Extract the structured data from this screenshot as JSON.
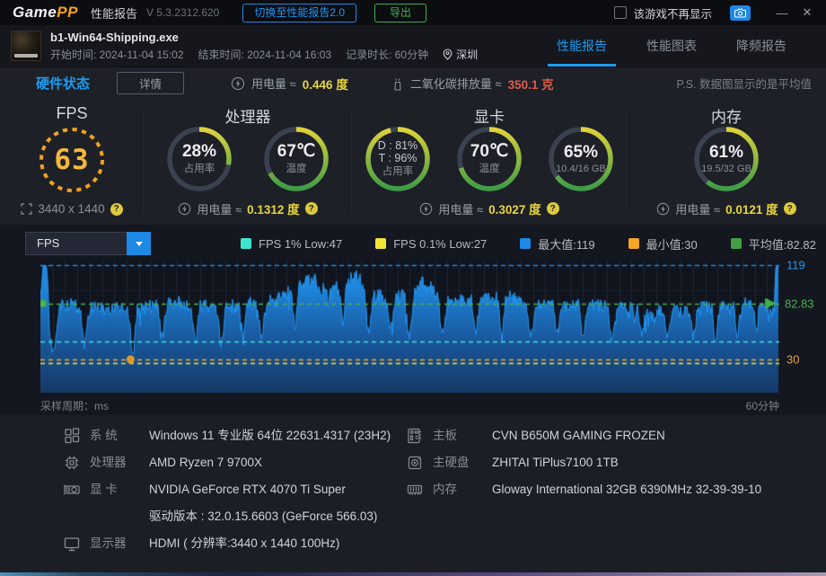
{
  "titlebar": {
    "logo_game": "Game",
    "logo_pp": "PP",
    "title": "性能报告",
    "version": "V 5.3.2312.620",
    "switch_button": "切换至性能报告2.0",
    "export_button": "导出",
    "checkbox_label": "该游戏不再显示",
    "minimize": "—",
    "close": "✕"
  },
  "header": {
    "exe_name": "b1-Win64-Shipping.exe",
    "start_time": "开始时间: 2024-11-04 15:02",
    "end_time": "结束时间: 2024-11-04 16:03",
    "duration": "记录时长: 60分钟",
    "location": "深圳",
    "tabs": [
      {
        "label": "性能报告",
        "active": true
      },
      {
        "label": "性能图表",
        "active": false
      },
      {
        "label": "降频报告",
        "active": false
      }
    ]
  },
  "status_row": {
    "title": "硬件状态",
    "detail_button": "详情",
    "power_label": "用电量 ≈",
    "power_value": "0.446 度",
    "co2_label": "二氧化碳排放量 ≈",
    "co2_value": "350.1 克",
    "ps_note": "P.S. 数据图显示的是平均值"
  },
  "gauges": {
    "fps": {
      "title": "FPS",
      "value": "63",
      "resolution": "3440 x 1440"
    },
    "cpu": {
      "title": "处理器",
      "usage_value": "28%",
      "usage_label": "占用率",
      "usage_pct": 28,
      "temp_value": "67℃",
      "temp_label": "温度",
      "temp_pct": 67,
      "power_label": "用电量 ≈",
      "power_value": "0.1312 度"
    },
    "gpu": {
      "title": "显卡",
      "d_value": "D : 81%",
      "t_value": "T : 96%",
      "usage_label": "占用率",
      "usage_pct": 96,
      "temp_value": "70℃",
      "temp_label": "温度",
      "temp_pct": 70,
      "mem_value": "65%",
      "mem_sub": "10.4/16 GB",
      "mem_pct": 65,
      "power_label": "用电量 ≈",
      "power_value": "0.3027 度"
    },
    "ram": {
      "title": "内存",
      "value": "61%",
      "sub": "19.5/32 GB",
      "pct": 61,
      "power_label": "用电量 ≈",
      "power_value": "0.0121 度"
    }
  },
  "chart": {
    "selector": "FPS",
    "legend": [
      {
        "color": "#3ee6cf",
        "label": "FPS 1% Low:47"
      },
      {
        "color": "#f2e635",
        "label": "FPS 0.1% Low:27"
      },
      {
        "color": "#1e88e5",
        "label": "最大值:119"
      },
      {
        "color": "#f5a623",
        "label": "最小值:30"
      },
      {
        "color": "#43a047",
        "label": "平均值:82.82"
      }
    ],
    "y_label_max": "119",
    "y_label_avg": "82.83",
    "y_label_min": "30",
    "x_left_label": "采样周期：ms",
    "x_right_label": "60分钟"
  },
  "chart_data": {
    "type": "area",
    "title": "FPS 曲线 (60分钟)",
    "ylim": [
      0,
      125
    ],
    "stats": {
      "max": 119,
      "min": 30,
      "avg": 82.82,
      "low_1pct": 47,
      "low_01pct": 27
    },
    "guide_lines": [
      {
        "value": 119,
        "color": "#1e88e5"
      },
      {
        "value": 82.83,
        "color": "#4caf50"
      },
      {
        "value": 47,
        "color": "#3ee6cf"
      },
      {
        "value": 30,
        "color": "#f5a623"
      },
      {
        "value": 27,
        "color": "#f2e635"
      }
    ],
    "markers": [
      {
        "type": "avg-start-dot",
        "value": 82.83,
        "color": "#4caf50"
      },
      {
        "type": "min-dot",
        "x_frac": 0.122,
        "value": 30,
        "color": "#e09b2d"
      },
      {
        "type": "avg-arrow",
        "value": 82.83,
        "color": "#3fae4a"
      }
    ],
    "profile_x": [
      0,
      0.004,
      0.009,
      0.014,
      0.03,
      0.06,
      0.125,
      0.19,
      0.26,
      0.32,
      0.352,
      0.371,
      0.389,
      0.413,
      0.431,
      0.45,
      0.48,
      0.504,
      0.522,
      0.547,
      0.589,
      0.638,
      0.687,
      0.735,
      0.796,
      0.844,
      0.893,
      0.942,
      0.978,
      0.994,
      0.9965,
      1
    ],
    "profile_y": [
      90,
      119,
      119,
      50,
      82,
      79,
      77,
      83,
      80,
      85,
      100,
      105,
      90,
      103,
      108,
      92,
      86,
      98,
      103,
      88,
      86,
      88,
      80,
      82,
      78,
      74,
      78,
      80,
      85,
      75,
      119,
      119
    ],
    "dips": [
      [
        0.017,
        40,
        0.003
      ],
      [
        0.06,
        46,
        0.003
      ],
      [
        0.125,
        30,
        0.0025
      ],
      [
        0.165,
        52,
        0.0025
      ],
      [
        0.21,
        48,
        0.003
      ],
      [
        0.245,
        46,
        0.003
      ],
      [
        0.275,
        55,
        0.0025
      ],
      [
        0.3,
        50,
        0.003
      ],
      [
        0.345,
        62,
        0.0025
      ],
      [
        0.41,
        65,
        0.0025
      ],
      [
        0.445,
        52,
        0.003
      ],
      [
        0.475,
        58,
        0.0025
      ],
      [
        0.5,
        47,
        0.003
      ],
      [
        0.545,
        50,
        0.003
      ],
      [
        0.59,
        55,
        0.0025
      ],
      [
        0.625,
        52,
        0.0025
      ],
      [
        0.665,
        48,
        0.003
      ],
      [
        0.7,
        55,
        0.0025
      ],
      [
        0.735,
        50,
        0.0025
      ],
      [
        0.775,
        47,
        0.003
      ],
      [
        0.815,
        50,
        0.0025
      ],
      [
        0.85,
        55,
        0.0025
      ],
      [
        0.885,
        52,
        0.0025
      ],
      [
        0.915,
        50,
        0.0025
      ],
      [
        0.945,
        55,
        0.0025
      ],
      [
        0.97,
        60,
        0.0025
      ]
    ],
    "noise_seed": 1337,
    "noise_amp": 7
  },
  "sysinfo": {
    "left": [
      {
        "icon": "system",
        "label": "系 统",
        "lines": [
          "Windows 11 专业版 64位 22631.4317 (23H2)"
        ]
      },
      {
        "icon": "cpu",
        "label": "处理器",
        "lines": [
          "AMD Ryzen 7 9700X"
        ]
      },
      {
        "icon": "gpu",
        "label": "显 卡",
        "lines": [
          "NVIDIA GeForce RTX 4070 Ti Super",
          "驱动版本 : 32.0.15.6603 (GeForce 566.03)"
        ]
      },
      {
        "icon": "monitor",
        "label": "显示器",
        "lines": [
          "HDMI ( 分辨率:3440 x 1440 100Hz)"
        ]
      }
    ],
    "right": [
      {
        "icon": "motherboard",
        "label": "主板",
        "lines": [
          "CVN B650M GAMING FROZEN"
        ]
      },
      {
        "icon": "disk",
        "label": "主硬盘",
        "lines": [
          "ZHITAI TiPlus7100 1TB"
        ]
      },
      {
        "icon": "ram",
        "label": "内存",
        "lines": [
          "Gloway International 32GB 6390MHz 32-39-39-10"
        ]
      }
    ]
  }
}
